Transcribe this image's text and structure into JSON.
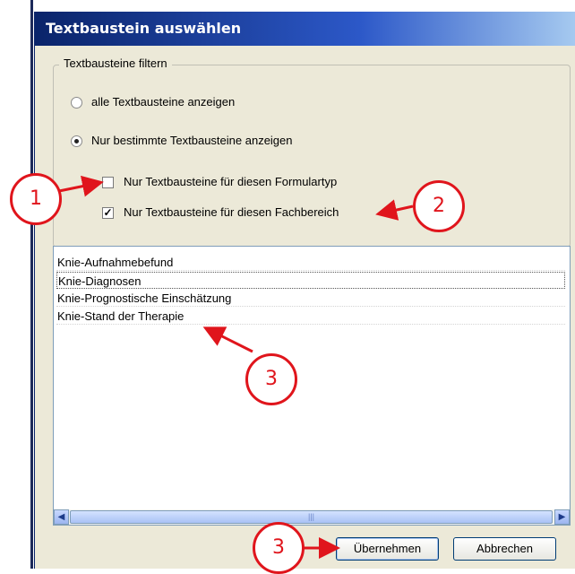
{
  "dialog": {
    "title": "Textbaustein auswählen",
    "filter_group": {
      "legend": "Textbausteine filtern",
      "radio_all": {
        "label": "alle Textbausteine anzeigen",
        "checked": false
      },
      "radio_specific": {
        "label": "Nur bestimmte Textbausteine anzeigen",
        "checked": true
      },
      "check_formulartyp": {
        "label": "Nur Textbausteine für diesen Formulartyp",
        "checked": false
      },
      "check_fachbereich": {
        "label": "Nur Textbausteine für diesen Fachbereich",
        "checked": true
      }
    },
    "list": {
      "items": [
        "Knie-Aufnahmebefund",
        "Knie-Diagnosen",
        "Knie-Prognostische Einschätzung",
        "Knie-Stand der Therapie"
      ],
      "focused_index": 1
    },
    "buttons": {
      "apply": "Übernehmen",
      "cancel": "Abbrechen"
    }
  },
  "annotations": {
    "callout_1": "1",
    "callout_2": "2",
    "callout_3a": "3",
    "callout_3b": "3",
    "color": "#e0151c"
  }
}
